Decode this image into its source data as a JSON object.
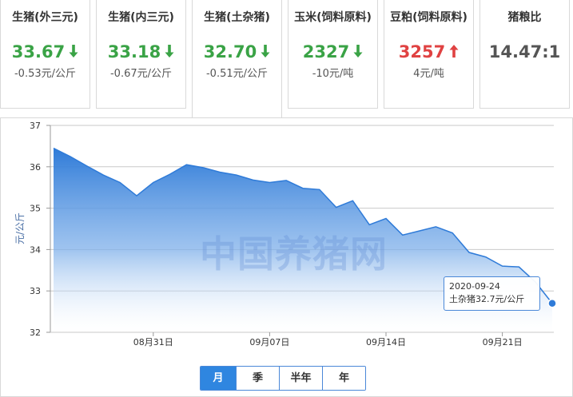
{
  "cards": [
    {
      "title": "生猪(外三元)",
      "price": "33.67",
      "trend": "down",
      "change": "-0.53元/公斤"
    },
    {
      "title": "生猪(内三元)",
      "price": "33.18",
      "trend": "down",
      "change": "-0.67元/公斤"
    },
    {
      "title": "生猪(土杂猪)",
      "price": "32.70",
      "trend": "down",
      "change": "-0.51元/公斤"
    },
    {
      "title": "玉米(饲料原料)",
      "price": "2327",
      "trend": "down",
      "change": "-10元/吨"
    },
    {
      "title": "豆粕(饲料原料)",
      "price": "3257",
      "trend": "up",
      "change": "4元/吨"
    },
    {
      "title": "猪粮比",
      "price": "14.47:1",
      "trend": "flat",
      "change": ""
    }
  ],
  "active_card": 2,
  "icons": {
    "down": "arrow-down-icon",
    "up": "arrow-up-icon"
  },
  "colors": {
    "down": "#3aa346",
    "up": "#e04242",
    "accent": "#2f86e0"
  },
  "watermark": "中国养猪网",
  "tooltip": {
    "date": "2020-09-24",
    "text": "土杂猪32.7元/公斤"
  },
  "range_tabs": [
    {
      "label": "月",
      "active": true
    },
    {
      "label": "季",
      "active": false
    },
    {
      "label": "半年",
      "active": false
    },
    {
      "label": "年",
      "active": false
    }
  ],
  "chart_data": {
    "type": "area",
    "ylabel": "元/公斤",
    "ylim": [
      32,
      37
    ],
    "yticks": [
      32,
      33,
      34,
      35,
      36,
      37
    ],
    "xlim": [
      "2020-08-25",
      "2020-09-24"
    ],
    "xticks": [
      "08月31日",
      "09月07日",
      "09月14日",
      "09月21日"
    ],
    "xtick_dates": [
      "2020-08-31",
      "2020-09-07",
      "2020-09-14",
      "2020-09-21"
    ],
    "grid": true,
    "series": [
      {
        "name": "土杂猪",
        "x": [
          "2020-08-25",
          "2020-08-26",
          "2020-08-27",
          "2020-08-28",
          "2020-08-29",
          "2020-08-30",
          "2020-08-31",
          "2020-09-01",
          "2020-09-02",
          "2020-09-03",
          "2020-09-04",
          "2020-09-05",
          "2020-09-06",
          "2020-09-07",
          "2020-09-08",
          "2020-09-09",
          "2020-09-10",
          "2020-09-11",
          "2020-09-12",
          "2020-09-13",
          "2020-09-14",
          "2020-09-15",
          "2020-09-16",
          "2020-09-17",
          "2020-09-18",
          "2020-09-19",
          "2020-09-20",
          "2020-09-21",
          "2020-09-22",
          "2020-09-23",
          "2020-09-24"
        ],
        "values": [
          36.45,
          36.25,
          36.02,
          35.8,
          35.62,
          35.3,
          35.62,
          35.82,
          36.05,
          35.98,
          35.87,
          35.8,
          35.68,
          35.62,
          35.67,
          35.48,
          35.45,
          35.02,
          35.18,
          34.6,
          34.75,
          34.35,
          34.45,
          34.55,
          34.4,
          33.93,
          33.82,
          33.6,
          33.58,
          33.21,
          32.7
        ]
      }
    ],
    "highlight": {
      "x": "2020-09-24",
      "y": 32.7
    }
  }
}
